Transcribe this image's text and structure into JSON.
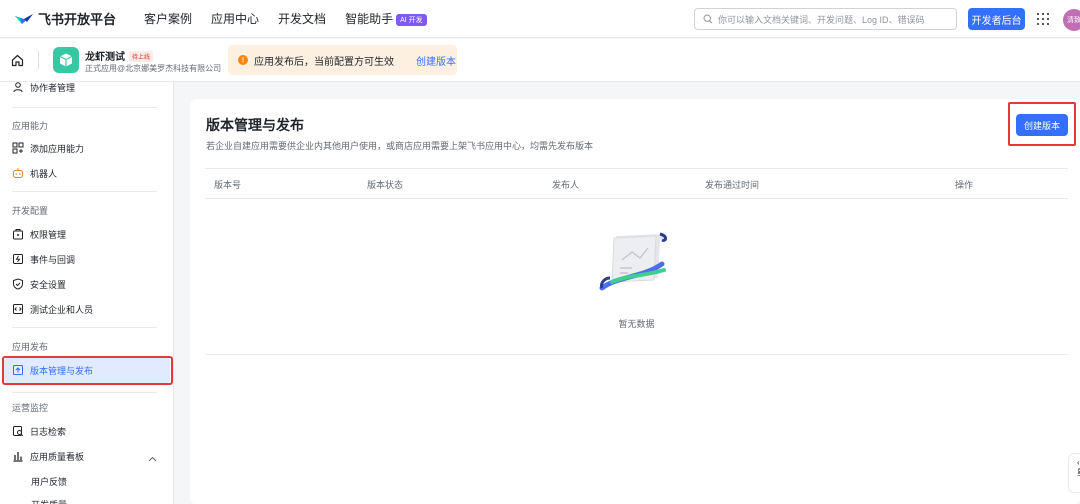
{
  "topnav": {
    "brand": "飞书开放平台",
    "links": [
      "客户案例",
      "应用中心",
      "开发文档",
      "智能助手"
    ],
    "ai_badge": "AI 开发",
    "search_placeholder": "你可以输入文档关键词、开发问题、Log ID、错误码",
    "dev_console": "开发者后台",
    "avatar_text": "清致"
  },
  "subhead": {
    "app_name": "龙虾测试",
    "status": "待上线",
    "org": "正式应用@北京娜美罗杰科技有限公司",
    "notice": "应用发布后，当前配置方可生效",
    "notice_link": "创建版本"
  },
  "sidebar": {
    "top_item": "协作者管理",
    "groups": {
      "capability": "应用能力",
      "dev_config": "开发配置",
      "release": "应用发布",
      "ops": "运营监控"
    },
    "items": {
      "add_capability": "添加应用能力",
      "bot": "机器人",
      "permissions": "权限管理",
      "events": "事件与回调",
      "security": "安全设置",
      "test_users": "测试企业和人员",
      "version": "版本管理与发布",
      "logs": "日志检索",
      "quality": "应用质量看板",
      "feedback": "用户反馈",
      "cut": "开发质量"
    }
  },
  "main": {
    "title": "版本管理与发布",
    "description": "若企业自建应用需要供企业内其他用户使用，或商店应用需要上架飞书应用中心，均需先发布版本",
    "create_button": "创建版本",
    "columns": [
      "版本号",
      "版本状态",
      "发布人",
      "发布通过时间",
      "操作"
    ],
    "empty_text": "暂无数据"
  },
  "float_text": "星"
}
